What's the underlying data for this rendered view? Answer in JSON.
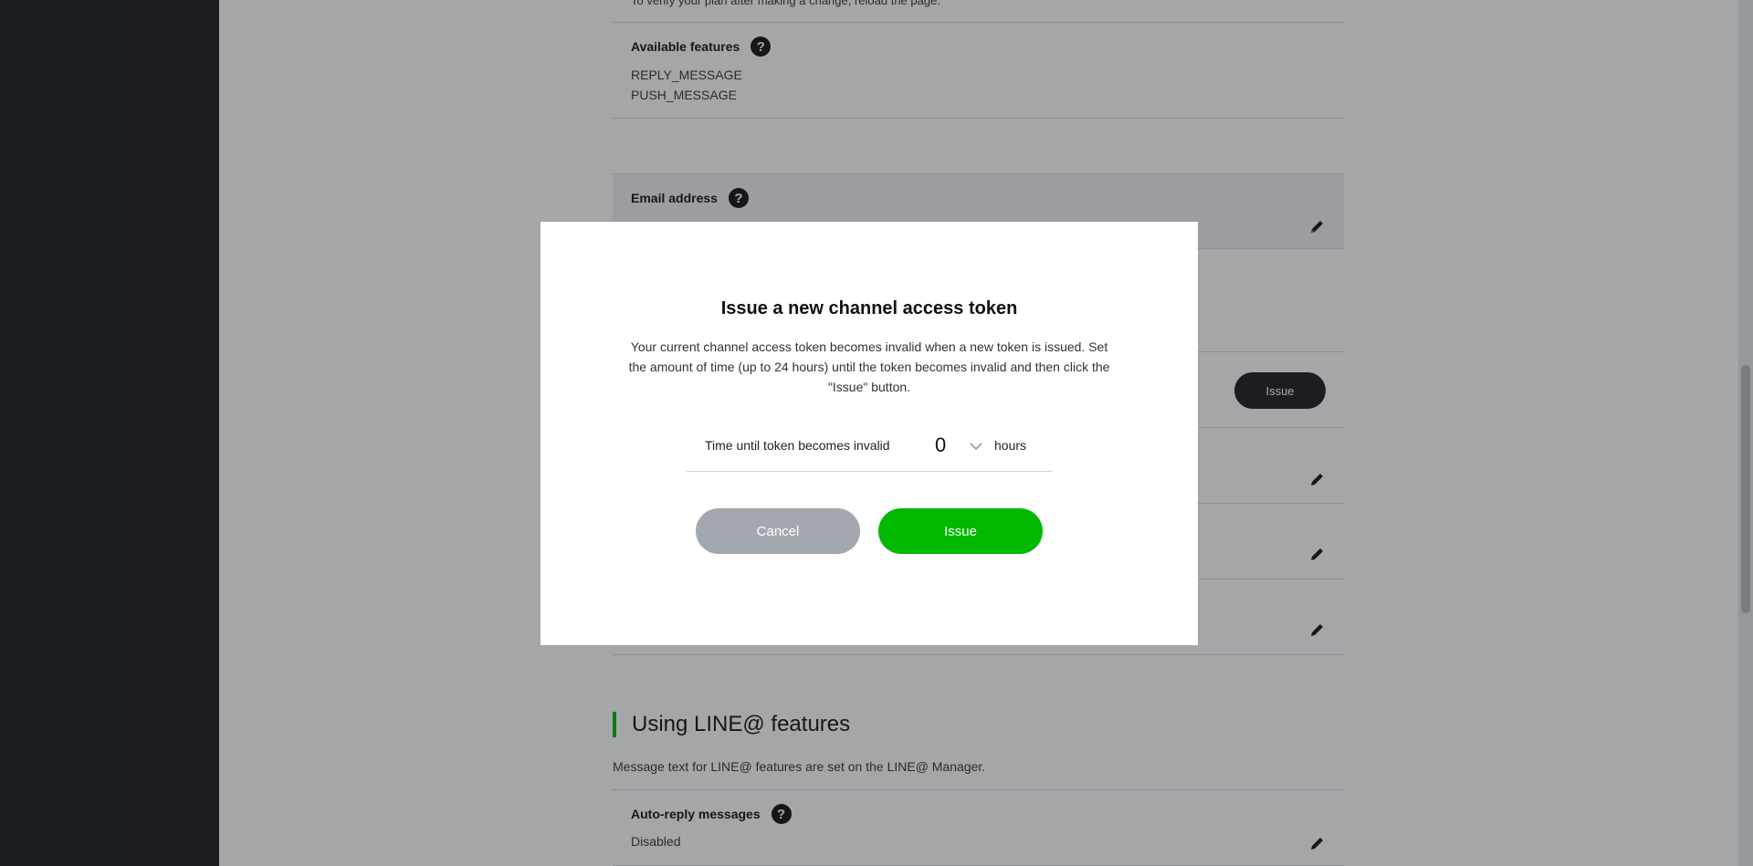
{
  "page": {
    "top_cut_text": "To verify your plan after making a change, reload the page.",
    "available_features": {
      "label": "Available features",
      "help_icon": "question-circle-icon",
      "items": [
        "REPLY_MESSAGE",
        "PUSH_MESSAGE"
      ]
    },
    "email_address": {
      "label": "Email address",
      "help_icon": "question-circle-icon",
      "edit_icon": "pencil-icon"
    },
    "issue_button_label": "Issue",
    "section": {
      "title": "Using LINE@ features",
      "description": "Message text for LINE@ features are set on the LINE@ Manager."
    },
    "auto_reply": {
      "label": "Auto-reply messages",
      "help_icon": "question-circle-icon",
      "value": "Disabled",
      "edit_icon": "pencil-icon"
    }
  },
  "modal": {
    "title": "Issue a new channel access token",
    "body": "Your current channel access token becomes invalid when a new token is issued. Set the amount of time (up to 24 hours) until the token becomes invalid and then click the \"Issue\" button.",
    "token_label": "Time until token becomes invalid",
    "token_value": "0",
    "token_unit": "hours",
    "chevron_icon": "chevron-down-icon",
    "cancel_label": "Cancel",
    "issue_label": "Issue"
  },
  "colors": {
    "accent_green": "#00b900",
    "sidebar": "#1b1c1f",
    "cancel_gray": "#a3a8ae"
  }
}
